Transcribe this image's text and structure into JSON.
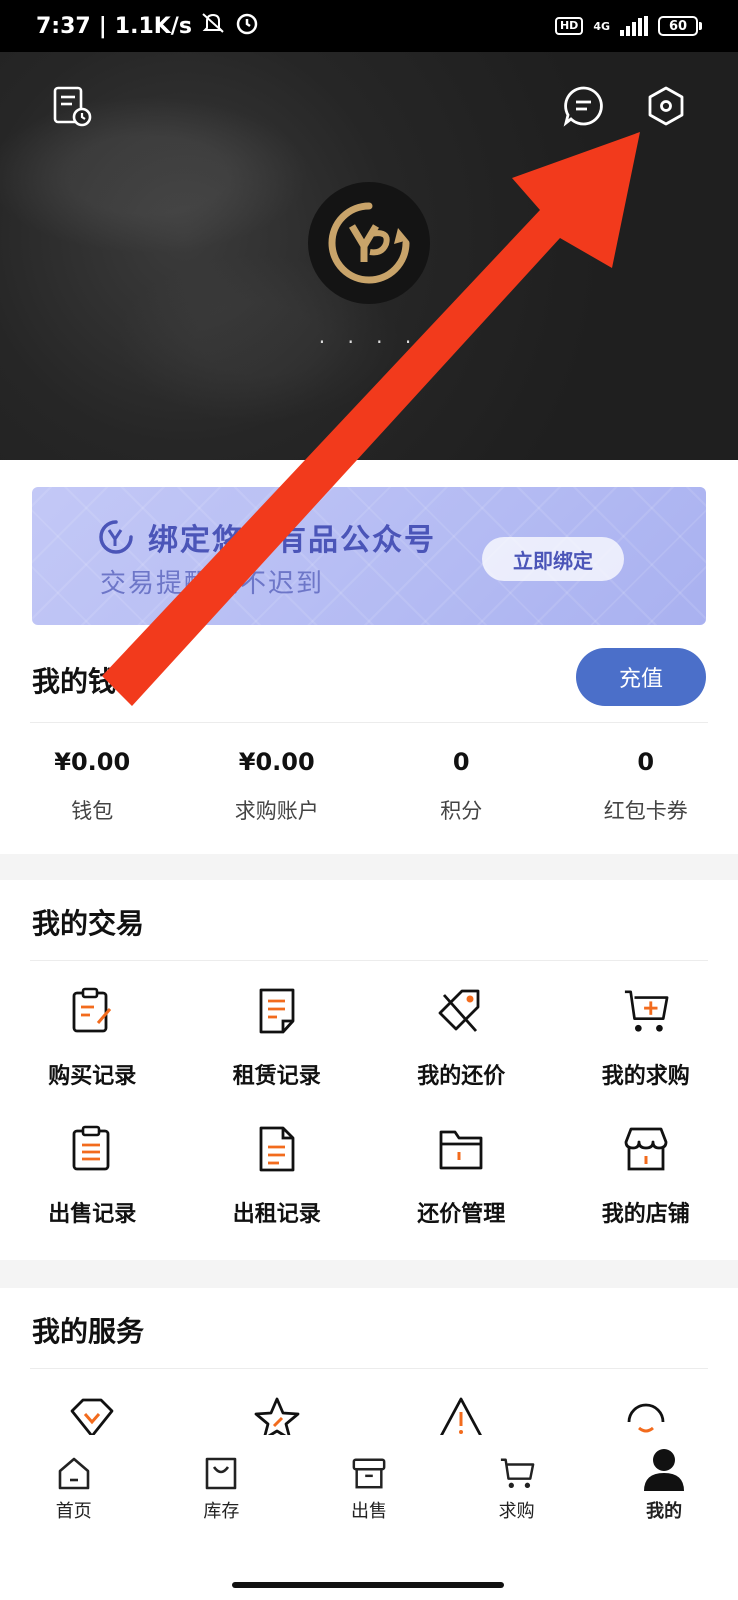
{
  "status_bar": {
    "time": "7:37",
    "speed": "1.1K/s",
    "hd": "HD",
    "network": "4G",
    "battery": "60"
  },
  "header": {
    "username": "· · · ·"
  },
  "banner": {
    "title": "绑定悠悠有品公众号",
    "subtitle": "交易提醒从不迟到",
    "button": "立即绑定"
  },
  "wallet": {
    "title": "我的钱包",
    "recharge": "充值",
    "stats": [
      {
        "value": "¥0.00",
        "label": "钱包"
      },
      {
        "value": "¥0.00",
        "label": "求购账户"
      },
      {
        "value": "0",
        "label": "积分"
      },
      {
        "value": "0",
        "label": "红包卡券"
      }
    ]
  },
  "trade": {
    "title": "我的交易",
    "items": [
      {
        "label": "购买记录",
        "icon": "purchase-record-icon"
      },
      {
        "label": "租赁记录",
        "icon": "lease-record-icon"
      },
      {
        "label": "我的还价",
        "icon": "price-tag-icon"
      },
      {
        "label": "我的求购",
        "icon": "cart-plus-icon"
      },
      {
        "label": "出售记录",
        "icon": "sale-record-icon"
      },
      {
        "label": "出租记录",
        "icon": "rental-record-icon"
      },
      {
        "label": "还价管理",
        "icon": "folder-icon"
      },
      {
        "label": "我的店铺",
        "icon": "store-icon"
      }
    ]
  },
  "service": {
    "title": "我的服务"
  },
  "tabs": [
    {
      "label": "首页",
      "icon": "home-icon"
    },
    {
      "label": "库存",
      "icon": "bag-icon"
    },
    {
      "label": "出售",
      "icon": "box-icon"
    },
    {
      "label": "求购",
      "icon": "cart-icon"
    },
    {
      "label": "我的",
      "icon": "person-icon"
    }
  ],
  "colors": {
    "accent": "#f26b1d",
    "primary_blue": "#4b6fc9",
    "annotation_arrow": "#f23a1c"
  }
}
